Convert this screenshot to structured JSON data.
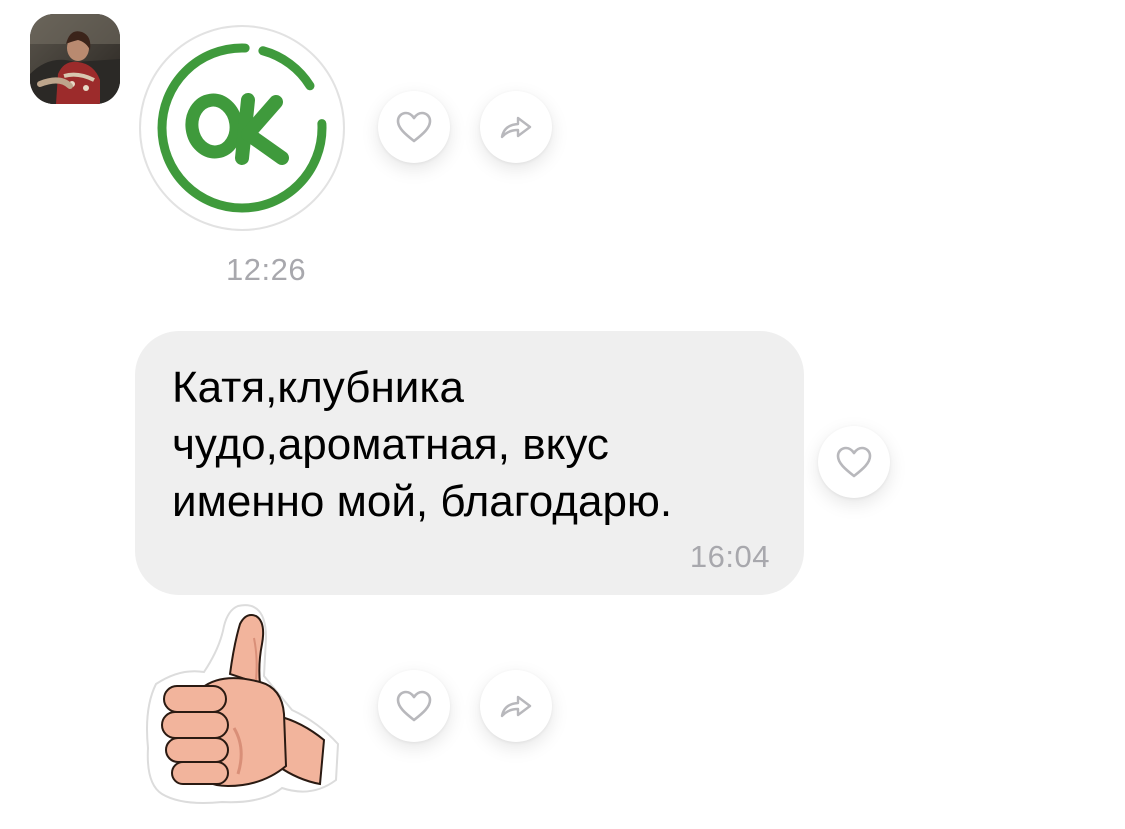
{
  "messages": [
    {
      "type": "sticker",
      "sticker": "ok-sticker",
      "sticker_text": "OK",
      "time": "12:26",
      "actions": [
        "heart-icon",
        "share-icon"
      ]
    },
    {
      "type": "text",
      "text": "Катя,клубника\nчудо,ароматная, вкус\nименно мой, благодарю.",
      "time": "16:04",
      "actions": [
        "heart-icon"
      ]
    },
    {
      "type": "sticker",
      "sticker": "thumbs-up-sticker",
      "actions": [
        "heart-icon",
        "share-icon"
      ]
    }
  ],
  "colors": {
    "ok_green": "#3f9a3c",
    "bubble_bg": "#efefef",
    "meta_gray": "#a8a8ad",
    "icon_gray": "#b8b8bc",
    "skin": "#f2b49c"
  }
}
